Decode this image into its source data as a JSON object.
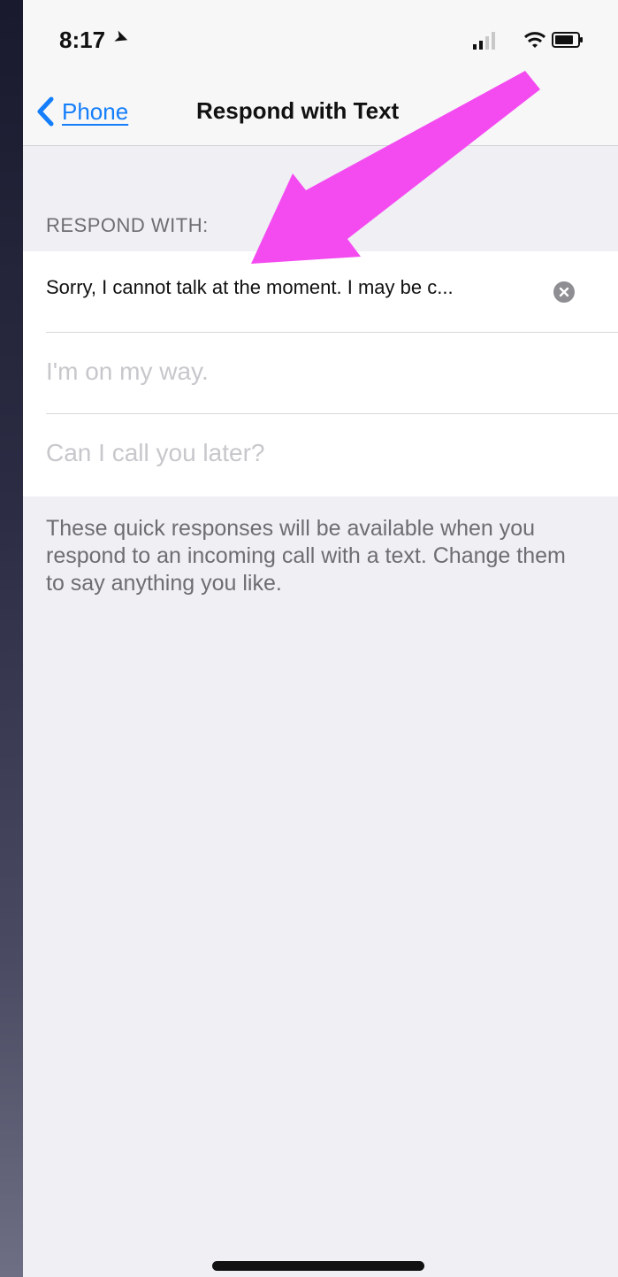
{
  "status_bar": {
    "time": "8:17"
  },
  "nav": {
    "back_label": "Phone",
    "title": "Respond with Text"
  },
  "section": {
    "header": "RESPOND WITH:"
  },
  "responses": [
    {
      "value": "Sorry, I cannot talk at the moment. I may be c...",
      "placeholder": ""
    },
    {
      "value": "",
      "placeholder": "I'm on my way."
    },
    {
      "value": "",
      "placeholder": "Can I call you later?"
    }
  ],
  "footer": {
    "text": "These quick responses will be available when you respond to an incoming call with a text. Change them to say anything you like."
  },
  "colors": {
    "accent": "#147efb",
    "annotation_arrow": "#f44bf1",
    "group_background": "#efeff4",
    "placeholder": "#c7c7cc"
  },
  "icons": {
    "back": "chevron-left-icon",
    "clear": "clear-circle-icon",
    "location": "location-arrow-icon",
    "signal": "cellular-signal-icon",
    "wifi": "wifi-icon",
    "battery": "battery-icon",
    "annotation": "pink-arrow-icon"
  }
}
